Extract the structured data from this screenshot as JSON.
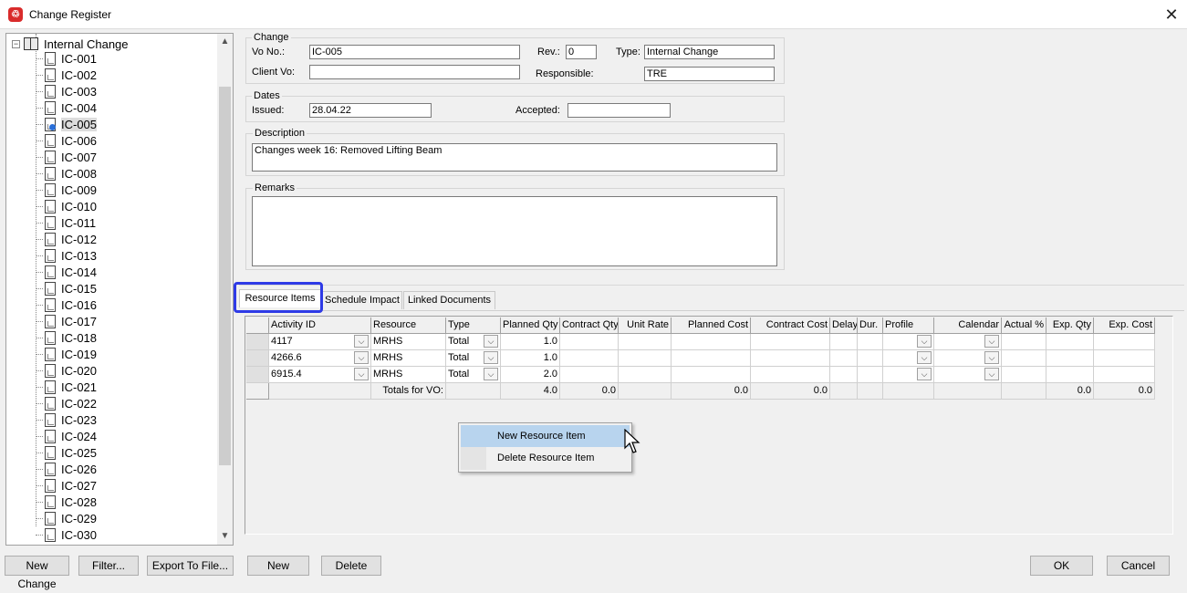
{
  "window": {
    "title": "Change Register",
    "close_glyph": "✕"
  },
  "tree": {
    "root_label": "Internal Change",
    "items": [
      "IC-001",
      "IC-002",
      "IC-003",
      "IC-004",
      "IC-005",
      "IC-006",
      "IC-007",
      "IC-008",
      "IC-009",
      "IC-010",
      "IC-011",
      "IC-012",
      "IC-013",
      "IC-014",
      "IC-015",
      "IC-016",
      "IC-017",
      "IC-018",
      "IC-019",
      "IC-020",
      "IC-021",
      "IC-022",
      "IC-023",
      "IC-024",
      "IC-025",
      "IC-026",
      "IC-027",
      "IC-028",
      "IC-029",
      "IC-030"
    ],
    "selected": "IC-005"
  },
  "change": {
    "group_label": "Change",
    "vo_label": "Vo No.:",
    "vo_value": "IC-005",
    "rev_label": "Rev.:",
    "rev_value": "0",
    "type_label": "Type:",
    "type_value": "Internal Change",
    "client_vo_label": "Client Vo:",
    "client_vo_value": "",
    "responsible_label": "Responsible:",
    "responsible_value": "TRE"
  },
  "dates": {
    "group_label": "Dates",
    "issued_label": "Issued:",
    "issued_value": "28.04.22",
    "accepted_label": "Accepted:",
    "accepted_value": ""
  },
  "description": {
    "group_label": "Description",
    "value": "Changes week 16: Removed Lifting Beam"
  },
  "remarks": {
    "group_label": "Remarks",
    "value": ""
  },
  "tabs": [
    "Resource Items",
    "Schedule Impact",
    "Linked Documents"
  ],
  "grid": {
    "columns": [
      "Activity ID",
      "Resource",
      "Type",
      "Planned Qty",
      "Contract Qty",
      "Unit Rate",
      "Planned Cost",
      "Contract Cost",
      "Delay",
      "Dur.",
      "Profile",
      "Calendar",
      "Actual %",
      "Exp. Qty",
      "Exp. Cost"
    ],
    "rows": [
      {
        "activity": "4117",
        "resource": "MRHS",
        "type": "Total",
        "planned_qty": "1.0"
      },
      {
        "activity": "4266.6",
        "resource": "MRHS",
        "type": "Total",
        "planned_qty": "1.0"
      },
      {
        "activity": "6915.4",
        "resource": "MRHS",
        "type": "Total",
        "planned_qty": "2.0"
      }
    ],
    "totals": {
      "label": "Totals for VO:",
      "planned_qty": "4.0",
      "contract_qty": "0.0",
      "planned_cost": "0.0",
      "contract_cost": "0.0",
      "exp_qty": "0.0",
      "exp_cost": "0.0"
    }
  },
  "context_menu": [
    "New Resource Item",
    "Delete Resource Item"
  ],
  "buttons": {
    "new_change": "New Change",
    "filter": "Filter...",
    "export": "Export To File...",
    "new": "New",
    "delete": "Delete",
    "ok": "OK",
    "cancel": "Cancel"
  }
}
